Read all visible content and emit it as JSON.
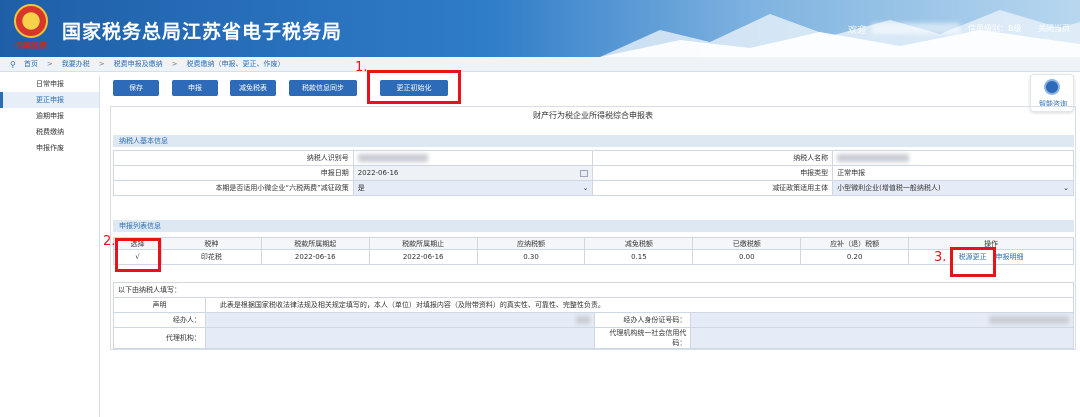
{
  "header": {
    "title": "国家税务总局江苏省电子税务局",
    "emblem_text": "中国税务",
    "welcome": "欢迎",
    "credit": "信用级别：B级",
    "close_page": "关闭当页"
  },
  "breadcrumb": [
    "首页",
    "我要办税",
    "税费申报及缴纳",
    "税费缴纳（申报、更正、作废）"
  ],
  "sidebar": [
    "日常申报",
    "更正申报",
    "逾期申报",
    "税费缴纳",
    "申报作废"
  ],
  "toolbar": {
    "save": "保存",
    "submit": "申报",
    "reduce": "减免税表",
    "sync": "税款信息同步",
    "init": "更正初始化"
  },
  "steps": [
    "1.",
    "2.",
    "3."
  ],
  "help": "智能咨询",
  "form_title": "财产行为税企业所得税综合申报表",
  "taxpayer_section": {
    "title": "纳税人基本信息",
    "id_label": "纳税人识别号",
    "name_label": "纳税人名称",
    "date_label": "申报日期",
    "date_value": "2022-06-16",
    "type_label": "申报类型",
    "type_value": "正常申报",
    "sme_label": "本期是否适用小微企业“六税两费”减征政策",
    "sme_value": "是",
    "subject_label": "减征政策适用主体",
    "subject_value": "小型微利企业(增值税一般纳税人)"
  },
  "list_section": {
    "title": "申报列表信息",
    "headers": [
      "选择",
      "税种",
      "税款所属期起",
      "税款所属期止",
      "应纳税额",
      "减免税额",
      "已缴税额",
      "应补（退）税额",
      "操作"
    ],
    "rows": [
      {
        "checked": "√",
        "tax": "印花税",
        "start": "2022-06-16",
        "end": "2022-06-16",
        "payable": "0.30",
        "reduced": "0.15",
        "paid": "0.00",
        "due": "0.20",
        "action1": "税源更正",
        "action2": "申报明细"
      }
    ]
  },
  "footer_section": {
    "title": "以下由纳税人填写：",
    "statement_label": "声明",
    "statement": "此表是根据国家税收法律法规及相关规定填写的，本人（单位）对填报内容（及附带资料）的真实性、可靠性、完整性负责。",
    "agent_label": "经办人：",
    "agent_id_label": "经办人身份证号码：",
    "org_label": "代理机构：",
    "org_code_label": "代理机构统一社会信用代码："
  },
  "colors": {
    "primary": "#2d6ab7",
    "highlight": "#e8121b",
    "section": "#dde8f3"
  }
}
